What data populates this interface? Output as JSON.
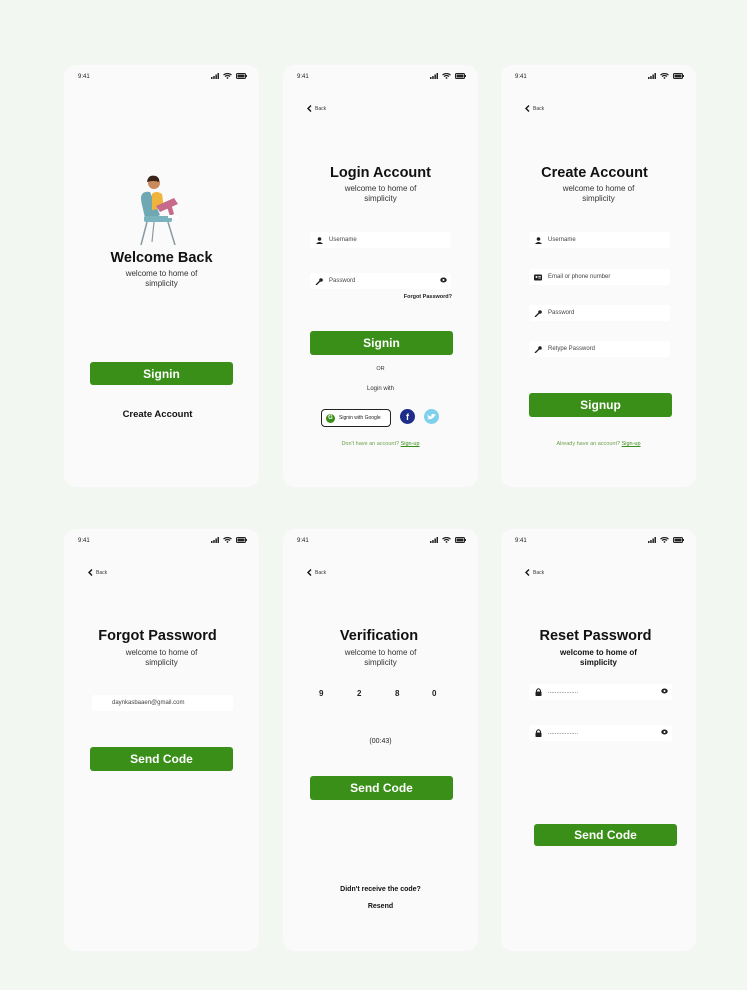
{
  "status_time": "9:41",
  "back_label": "Back",
  "colors": {
    "accent": "#3a8f18",
    "background": "#f3f7f1",
    "phone": "#fbfafb"
  },
  "welcome": {
    "title": "Welcome Back",
    "subtitle": "welcome to home of simplicity",
    "signin_label": "Signin",
    "create_label": "Create Account"
  },
  "login": {
    "title": "Login Account",
    "subtitle": "welcome to home of simplicity",
    "username_placeholder": "Username",
    "password_placeholder": "Password",
    "forgot_label": "Forgot Password?",
    "signin_label": "Signin",
    "or_label": "OR",
    "login_with_label": "Login with",
    "google_label": "Signin with Google",
    "signup_prompt": "Don't have an account?",
    "signup_link": "Sign-up"
  },
  "create": {
    "title": "Create Account",
    "subtitle": "welcome to home of simplicity",
    "username_placeholder": "Username",
    "email_placeholder": "Email or phone number",
    "password_placeholder": "Password",
    "retype_placeholder": "Retype Password",
    "signup_label": "Signup",
    "signin_prompt": "Already have an account?",
    "signin_link": "Sign-up"
  },
  "forgot": {
    "title": "Forgot Password",
    "subtitle": "welcome to home of simplicity",
    "email_value": "daynkasbaaen@gmail.com",
    "send_label": "Send Code"
  },
  "verification": {
    "title": "Verification",
    "subtitle": "welcome to home of simplicity",
    "digits": [
      "9",
      "2",
      "8",
      "0"
    ],
    "timer": "(00:43)",
    "send_label": "Send Code",
    "no_code_label": "Didn't receive the code?",
    "resend_label": "Resend"
  },
  "reset": {
    "title": "Reset Password",
    "subtitle": "welcome to home of simplicity",
    "password_value": "..................",
    "confirm_value": "..................",
    "send_label": "Send Code"
  }
}
